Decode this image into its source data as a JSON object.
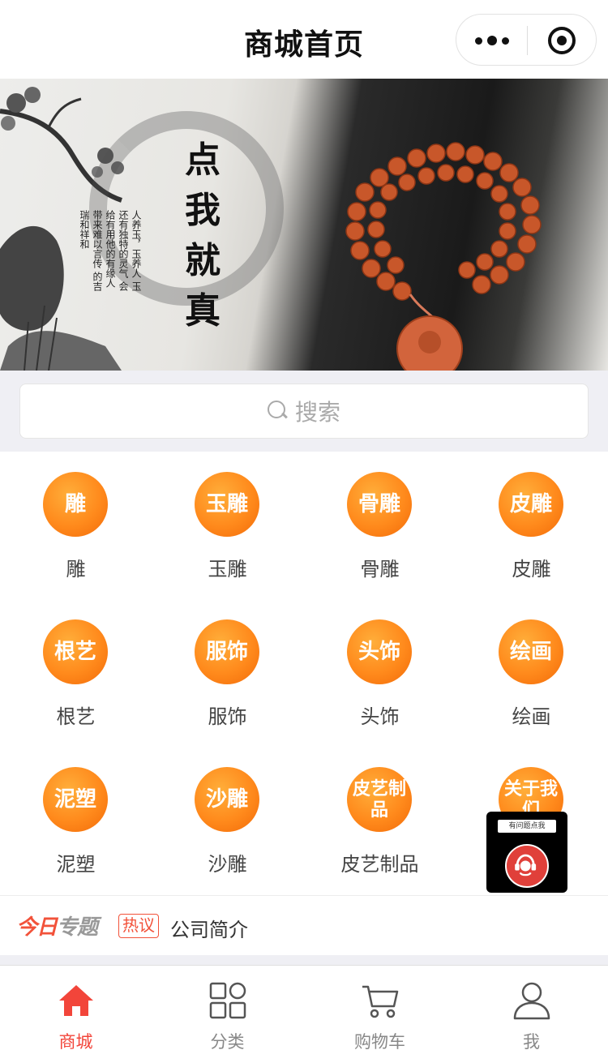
{
  "header": {
    "title": "商城首页",
    "more_icon": "more-dots-icon",
    "close_icon": "target-circle-icon"
  },
  "banner": {
    "slogan": "点我就真",
    "poem": "人养玉，玉养人 玉还有独特的灵气 会给有用他的有缘人 带来难以言传 的吉瑞和祥和",
    "dots_total": 2,
    "dots_active": 1
  },
  "search": {
    "placeholder": "搜索",
    "icon": "search-icon"
  },
  "categories": [
    {
      "icon_text": "雕",
      "label": "雕"
    },
    {
      "icon_text": "玉雕",
      "label": "玉雕"
    },
    {
      "icon_text": "骨雕",
      "label": "骨雕"
    },
    {
      "icon_text": "皮雕",
      "label": "皮雕"
    },
    {
      "icon_text": "根艺",
      "label": "根艺"
    },
    {
      "icon_text": "服饰",
      "label": "服饰"
    },
    {
      "icon_text": "头饰",
      "label": "头饰"
    },
    {
      "icon_text": "绘画",
      "label": "绘画"
    },
    {
      "icon_text": "泥塑",
      "label": "泥塑"
    },
    {
      "icon_text": "沙雕",
      "label": "沙雕"
    },
    {
      "icon_text": "皮艺制品",
      "label": "皮艺制品"
    },
    {
      "icon_text": "关于我们",
      "label": ""
    }
  ],
  "topic": {
    "brand_a": "今日",
    "brand_b": "专题",
    "tag": "热议",
    "text": "公司简介"
  },
  "service": {
    "bubble": "有问题点我",
    "icon": "customer-service-icon"
  },
  "tabbar": [
    {
      "label": "商城",
      "icon": "home-icon",
      "active": true
    },
    {
      "label": "分类",
      "icon": "category-grid-icon",
      "active": false
    },
    {
      "label": "购物车",
      "icon": "cart-icon",
      "active": false
    },
    {
      "label": "我",
      "icon": "user-icon",
      "active": false
    }
  ],
  "colors": {
    "accent": "#f2453a",
    "orange": "#ff8a1c",
    "bg_gray": "#efeff4"
  }
}
